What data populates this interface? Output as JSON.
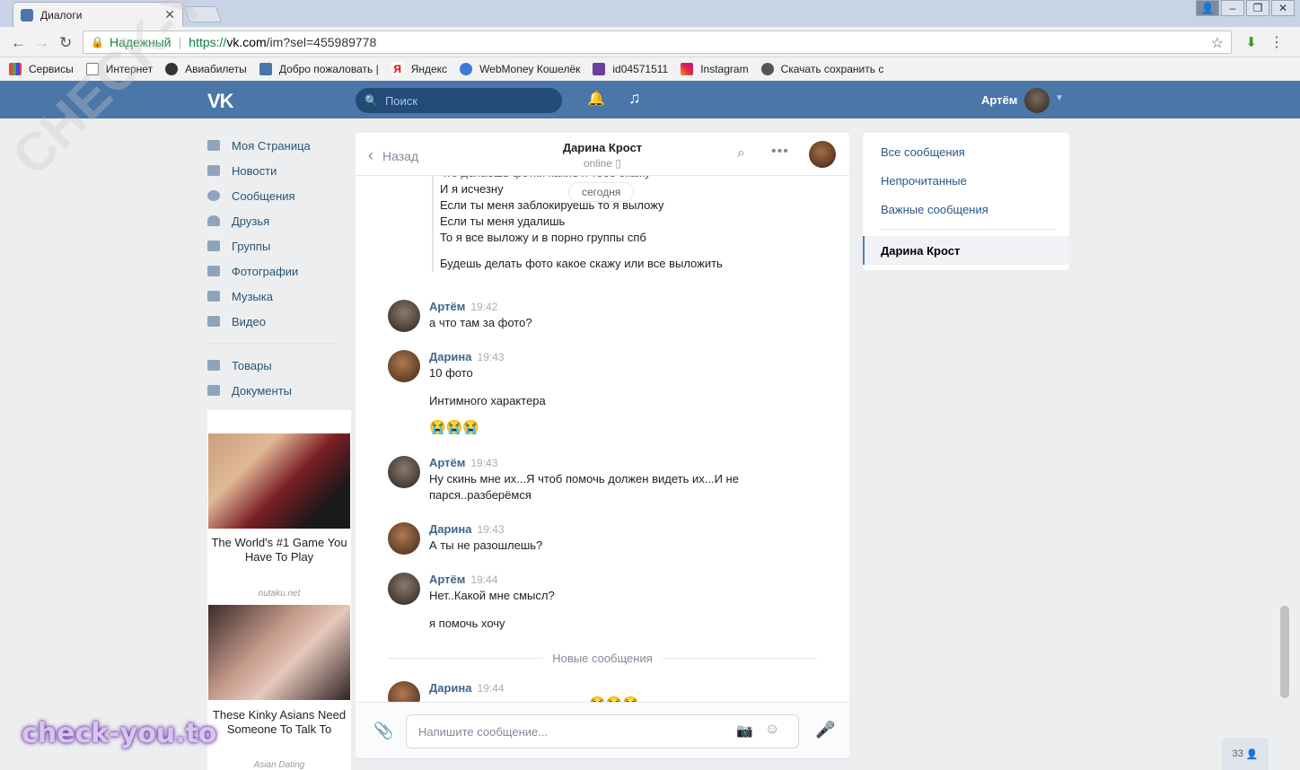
{
  "browser": {
    "tab_title": "Диалоги",
    "tab_close": "✕",
    "secure_label": "Надежный",
    "url_scheme": "https://",
    "url_host": "vk.com",
    "url_path": "/im?sel=455989778",
    "bookmarks": [
      "Сервисы",
      "Интернет",
      "Авиабилеты",
      "Добро пожаловать |",
      "Яндекс",
      "WebMoney Кошелёк",
      "id04571511",
      "Instagram",
      "Скачать сохранить с"
    ]
  },
  "vk_header": {
    "logo": "VK",
    "search_placeholder": "Поиск",
    "user_name": "Артём"
  },
  "left_nav": {
    "items": [
      "Моя Страница",
      "Новости",
      "Сообщения",
      "Друзья",
      "Группы",
      "Фотографии",
      "Музыка",
      "Видео"
    ],
    "items2": [
      "Товары",
      "Документы"
    ]
  },
  "ads": [
    {
      "title": "The World's #1 Game You Have To Play",
      "source": "nutaku.net"
    },
    {
      "title": "These Kinky Asians Need Someone To Talk To",
      "source": "Asian Dating"
    }
  ],
  "chat": {
    "back_label": "Назад",
    "peer_name": "Дарина Крост",
    "peer_status": "online",
    "date_pill": "сегодня",
    "forwarded": [
      "что делаешь фотки какие я тебе скажу",
      "И я исчезну",
      "Если ты меня заблокируешь то я выложу",
      "Если ты меня удалишь",
      "То я все выложу и в порно группы спб",
      "Будешь делать фото какое скажу или все выложить"
    ],
    "messages": [
      {
        "author": "Артём",
        "time": "19:42",
        "lines": [
          "а что там за фото?"
        ]
      },
      {
        "author": "Дарина",
        "time": "19:43",
        "lines": [
          "10 фото",
          "Интимного характера",
          "😭😭😭"
        ]
      },
      {
        "author": "Артём",
        "time": "19:43",
        "lines": [
          "Ну скинь мне их...Я чтоб помочь должен видеть их...И не",
          "парся..разберёмся"
        ]
      },
      {
        "author": "Дарина",
        "time": "19:43",
        "lines": [
          "А ты не разошлешь?"
        ]
      },
      {
        "author": "Артём",
        "time": "19:44",
        "lines": [
          "Нет..Какой мне смысл?",
          "я помочь хочу"
        ]
      },
      {
        "author": "Дарина",
        "time": "19:44",
        "lines": [
          "😭😭😭"
        ]
      }
    ],
    "new_messages_label": "Новые сообщения",
    "composer_placeholder": "Напишите сообщение..."
  },
  "right_nav": {
    "all": "Все сообщения",
    "unread": "Непрочитанные",
    "important": "Важные сообщения",
    "active_dialog": "Дарина Крост"
  },
  "counter": "33",
  "watermarks": {
    "diagonal": "CHECK-YOU.ME",
    "logo": "check-you.to"
  }
}
